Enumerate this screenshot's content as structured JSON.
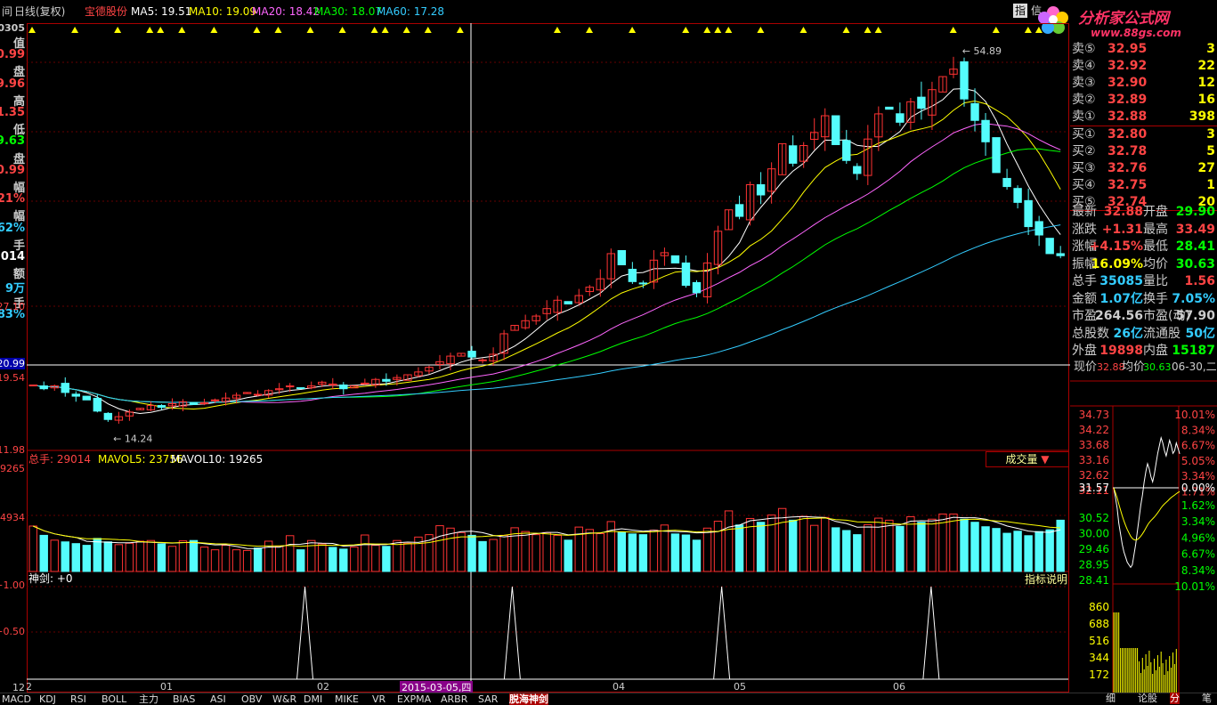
{
  "topbar": {
    "period_label": "日线(复权)",
    "stock_name": "宝德股份",
    "ma": [
      {
        "label": "MA5: 19.51",
        "color": "#ffffff"
      },
      {
        "label": "MA10: 19.09",
        "color": "#ffff00"
      },
      {
        "label": "MA20: 18.42",
        "color": "#ff66ff"
      },
      {
        "label": "MA30: 18.07",
        "color": "#00ff00"
      },
      {
        "label": "MA60: 17.28",
        "color": "#33ccff"
      }
    ],
    "right_buttons": [
      "指",
      "信"
    ]
  },
  "logo": {
    "title": "分析家公式网",
    "url": "www.88gs.com"
  },
  "left_panel": {
    "code_fragment": "0305",
    "items": [
      {
        "text": "值",
        "color": "#cccccc"
      },
      {
        "text": "0.99",
        "color": "#ff4444"
      },
      {
        "text": "盘",
        "color": "#cccccc"
      },
      {
        "text": "9.96",
        "color": "#ff4444"
      },
      {
        "text": "高",
        "color": "#cccccc"
      },
      {
        "text": "1.35",
        "color": "#ff4444"
      },
      {
        "text": "低",
        "color": "#cccccc"
      },
      {
        "text": "9.63",
        "color": "#00ff00"
      },
      {
        "text": "盘",
        "color": "#cccccc"
      },
      {
        "text": "0.99",
        "color": "#ff4444"
      },
      {
        "text": "幅",
        "color": "#cccccc"
      },
      {
        "text": "21%",
        "color": "#ff4444"
      },
      {
        "text": "幅",
        "color": "#cccccc"
      },
      {
        "text": "62%",
        "color": "#33ccff"
      },
      {
        "text": "手",
        "color": "#cccccc"
      },
      {
        "text": ",014",
        "color": "#ffffff"
      },
      {
        "text": "额",
        "color": "#cccccc"
      },
      {
        "text": "9万",
        "color": "#33ccff"
      },
      {
        "text": "手",
        "color": "#cccccc"
      },
      {
        "text": "83%",
        "color": "#33ccff"
      }
    ],
    "axis_labels": [
      "27.10",
      "20.99",
      "19.54",
      "11.98",
      "9265",
      "4934",
      "+1.00",
      "+0.50",
      "12"
    ]
  },
  "chart_data": [
    {
      "type": "candlestick",
      "title": "日线(复权) 宝德股份",
      "x_labels": [
        "12",
        "01",
        "02",
        "2015-03-05,四",
        "04",
        "05",
        "06"
      ],
      "price_labels": {
        "high": "54.89",
        "low": "14.24",
        "crosshair": "20.99",
        "last_close": "19.54",
        "axis_top": "27.10",
        "axis_bottom": "11.98"
      },
      "ylim": [
        11.98,
        56.5
      ],
      "close": [
        19.0,
        18.6,
        18.9,
        18.2,
        17.8,
        17.4,
        16.2,
        15.3,
        15.6,
        16.1,
        16.5,
        16.8,
        16.6,
        17.0,
        17.2,
        16.9,
        17.1,
        17.4,
        17.6,
        17.9,
        18.2,
        18.0,
        18.4,
        18.6,
        18.9,
        18.7,
        18.9,
        19.3,
        19.1,
        18.6,
        18.9,
        19.2,
        19.6,
        19.4,
        19.8,
        20.1,
        20.4,
        20.9,
        21.5,
        22.1,
        22.4,
        22.0,
        21.7,
        22.3,
        24.5,
        25.4,
        25.9,
        26.4,
        27.2,
        28.1,
        27.7,
        28.6,
        29.5,
        30.4,
        33.1,
        31.9,
        30.1,
        29.9,
        32.4,
        33.2,
        32.1,
        29.7,
        28.9,
        32.1,
        35.5,
        37.8,
        37.1,
        40.5,
        39.4,
        42.2,
        44.9,
        42.8,
        44.7,
        46.1,
        47.9,
        44.8,
        43.1,
        41.7,
        45.4,
        48.1,
        48.6,
        47.2,
        49.4,
        48.7,
        50.7,
        52.1,
        52.9,
        49.7,
        47.4,
        45.1,
        41.8,
        40.3,
        38.6,
        36.0,
        35.1,
        33.1,
        32.88
      ],
      "ma_series": [
        {
          "name": "MA5",
          "color": "#ffffff"
        },
        {
          "name": "MA10",
          "color": "#ffff00"
        },
        {
          "name": "MA20",
          "color": "#ff66ff"
        },
        {
          "name": "MA30",
          "color": "#00ff00"
        },
        {
          "name": "MA60",
          "color": "#33ccff"
        }
      ]
    },
    {
      "type": "bar",
      "title": "成交量",
      "legend": [
        "总手: 29014",
        "MAVOL5: 23756",
        "MAVOL10: 19265"
      ],
      "axis_labels": [
        "9265",
        "4934"
      ],
      "ylim": [
        0,
        30000
      ],
      "values": [
        13200,
        10500,
        9100,
        8600,
        8100,
        7600,
        9600,
        8600,
        7800,
        8200,
        8800,
        9000,
        8000,
        7300,
        8900,
        9000,
        7100,
        6300,
        7600,
        6300,
        6100,
        6800,
        8800,
        7300,
        10400,
        6300,
        9000,
        8000,
        7000,
        6500,
        7100,
        10600,
        7600,
        7300,
        9000,
        8200,
        10000,
        10700,
        13300,
        12600,
        11300,
        10500,
        8700,
        9300,
        10500,
        12700,
        11600,
        10700,
        11300,
        10500,
        9100,
        12900,
        12200,
        11000,
        14500,
        11500,
        10900,
        10700,
        12000,
        13500,
        10900,
        10600,
        9100,
        12600,
        14600,
        17600,
        13500,
        15400,
        14300,
        16400,
        18300,
        14900,
        16000,
        13400,
        15700,
        12700,
        11900,
        10700,
        13600,
        15500,
        14900,
        13100,
        15900,
        14300,
        15200,
        16700,
        16700,
        15200,
        14300,
        13000,
        12500,
        11100,
        11700,
        10400,
        11600,
        12100,
        14900
      ]
    },
    {
      "type": "line",
      "title": "神剑",
      "legend": [
        "神剑: +0"
      ],
      "axis_labels": [
        "+1.00",
        "+0.50"
      ],
      "ylim": [
        0,
        1
      ],
      "signal_indices": [
        25,
        43,
        62,
        81
      ]
    },
    {
      "type": "line",
      "title": "分时",
      "price_ticks": [
        "34.73",
        "34.22",
        "33.68",
        "33.16",
        "32.62",
        "32.11",
        "31.57",
        "30.52",
        "30.00",
        "29.46",
        "28.95",
        "28.41"
      ],
      "pct_ticks": [
        "10.01%",
        "8.34%",
        "6.67%",
        "5.05%",
        "3.34%",
        "1.71%",
        "0.00%",
        "1.62%",
        "3.34%",
        "4.96%",
        "6.67%",
        "8.34%",
        "10.01%"
      ],
      "volume_ticks": [
        "860",
        "688",
        "516",
        "344",
        "172"
      ],
      "prices": [
        31.57,
        31.2,
        30.8,
        30.2,
        29.8,
        29.4,
        29.1,
        28.9,
        28.7,
        28.6,
        28.5,
        28.6,
        29.0,
        29.4,
        29.9,
        30.4,
        30.9,
        31.3,
        31.8,
        32.2,
        32.5,
        32.3,
        32.0,
        31.8,
        32.1,
        32.5,
        32.9,
        33.2,
        33.5,
        33.3,
        33.0,
        32.8,
        33.1,
        33.4,
        33.2,
        32.9,
        33.0,
        33.3,
        33.1,
        32.88
      ]
    }
  ],
  "quote_panel": {
    "sell": [
      {
        "label": "卖⑤",
        "price": "32.95",
        "vol": "3"
      },
      {
        "label": "卖④",
        "price": "32.92",
        "vol": "22"
      },
      {
        "label": "卖③",
        "price": "32.90",
        "vol": "12"
      },
      {
        "label": "卖②",
        "price": "32.89",
        "vol": "16"
      },
      {
        "label": "卖①",
        "price": "32.88",
        "vol": "398"
      }
    ],
    "buy": [
      {
        "label": "买①",
        "price": "32.80",
        "vol": "3"
      },
      {
        "label": "买②",
        "price": "32.78",
        "vol": "5"
      },
      {
        "label": "买③",
        "price": "32.76",
        "vol": "27"
      },
      {
        "label": "买④",
        "price": "32.75",
        "vol": "1"
      },
      {
        "label": "买⑤",
        "price": "32.74",
        "vol": "20"
      }
    ],
    "stats": [
      {
        "l1": "最新",
        "v1": "32.88",
        "c1": "#ff4444",
        "l2": "开盘",
        "v2": "29.90",
        "c2": "#00ff00"
      },
      {
        "l1": "涨跌",
        "v1": "+1.31",
        "c1": "#ff4444",
        "l2": "最高",
        "v2": "33.49",
        "c2": "#ff4444"
      },
      {
        "l1": "涨幅",
        "v1": "+4.15%",
        "c1": "#ff4444",
        "l2": "最低",
        "v2": "28.41",
        "c2": "#00ff00"
      },
      {
        "l1": "振幅",
        "v1": "16.09%",
        "c1": "#ffff00",
        "l2": "均价",
        "v2": "30.63",
        "c2": "#00ff00"
      },
      {
        "l1": "总手",
        "v1": "35085",
        "c1": "#33ccff",
        "l2": "量比",
        "v2": "1.56",
        "c2": "#ff4444"
      },
      {
        "l1": "金额",
        "v1": "1.07亿",
        "c1": "#33ccff",
        "l2": "换手",
        "v2": "7.05%",
        "c2": "#33ccff"
      },
      {
        "l1": "市盈",
        "v1": "264.56",
        "c1": "#cccccc",
        "l2": "市盈(动)",
        "v2": "57.90",
        "c2": "#cccccc"
      },
      {
        "l1": "总股数",
        "v1": "26亿",
        "c1": "#33ccff",
        "l2": "流通股",
        "v2": "50亿",
        "c2": "#33ccff"
      },
      {
        "l1": "外盘",
        "v1": "19898",
        "c1": "#ff4444",
        "l2": "内盘",
        "v2": "15187",
        "c2": "#00ff00"
      }
    ],
    "intraday_header": {
      "price_label": "现价",
      "price": "32.88",
      "avg_label": "均价",
      "avg": "30.63",
      "date": "06-30,二"
    }
  },
  "bottom_tabs": [
    "MACD",
    "KDJ",
    "RSI",
    "BOLL",
    "主力",
    "BIAS",
    "ASI",
    "OBV",
    "W&R",
    "DMI",
    "MIKE",
    "VR",
    "EXPMA",
    "ARBR",
    "SAR",
    "脱海神剑"
  ],
  "right_tabs": [
    "细",
    "论股",
    "分",
    "笔"
  ],
  "volume_button": "成交量",
  "indicator_help": "指标说明"
}
